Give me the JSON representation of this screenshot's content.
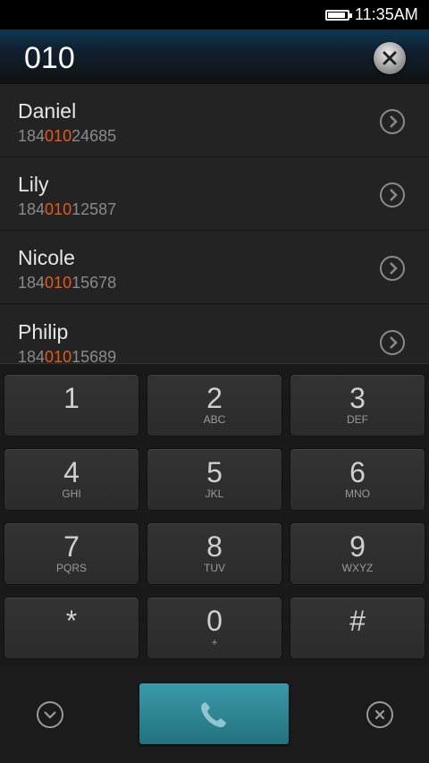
{
  "status_bar": {
    "time": "11:35AM",
    "battery_level": 0.9
  },
  "dialer": {
    "dialed_number": "010"
  },
  "contacts": [
    {
      "name": "Daniel",
      "number_prefix": "184",
      "number_match": "010",
      "number_suffix": "24685"
    },
    {
      "name": "Lily",
      "number_prefix": "184",
      "number_match": "010",
      "number_suffix": "12587"
    },
    {
      "name": "Nicole",
      "number_prefix": "184",
      "number_match": "010",
      "number_suffix": "15678"
    },
    {
      "name": "Philip",
      "number_prefix": "184",
      "number_match": "010",
      "number_suffix": "15689"
    }
  ],
  "keypad": {
    "keys": [
      {
        "digit": "1",
        "letters": ""
      },
      {
        "digit": "2",
        "letters": "ABC"
      },
      {
        "digit": "3",
        "letters": "DEF"
      },
      {
        "digit": "4",
        "letters": "GHI"
      },
      {
        "digit": "5",
        "letters": "JKL"
      },
      {
        "digit": "6",
        "letters": "MNO"
      },
      {
        "digit": "7",
        "letters": "PQRS"
      },
      {
        "digit": "8",
        "letters": "TUV"
      },
      {
        "digit": "9",
        "letters": "WXYZ"
      },
      {
        "digit": "*",
        "letters": ""
      },
      {
        "digit": "0",
        "letters": "+"
      },
      {
        "digit": "#",
        "letters": ""
      }
    ]
  },
  "icons": {
    "clear": "close-icon",
    "contact_detail": "chevron-right-icon",
    "collapse": "chevron-down-icon",
    "call": "phone-icon",
    "delete": "backspace-icon"
  },
  "colors": {
    "accent": "#e6581b",
    "call_button": "#2f8795",
    "header": "#0d3850"
  }
}
